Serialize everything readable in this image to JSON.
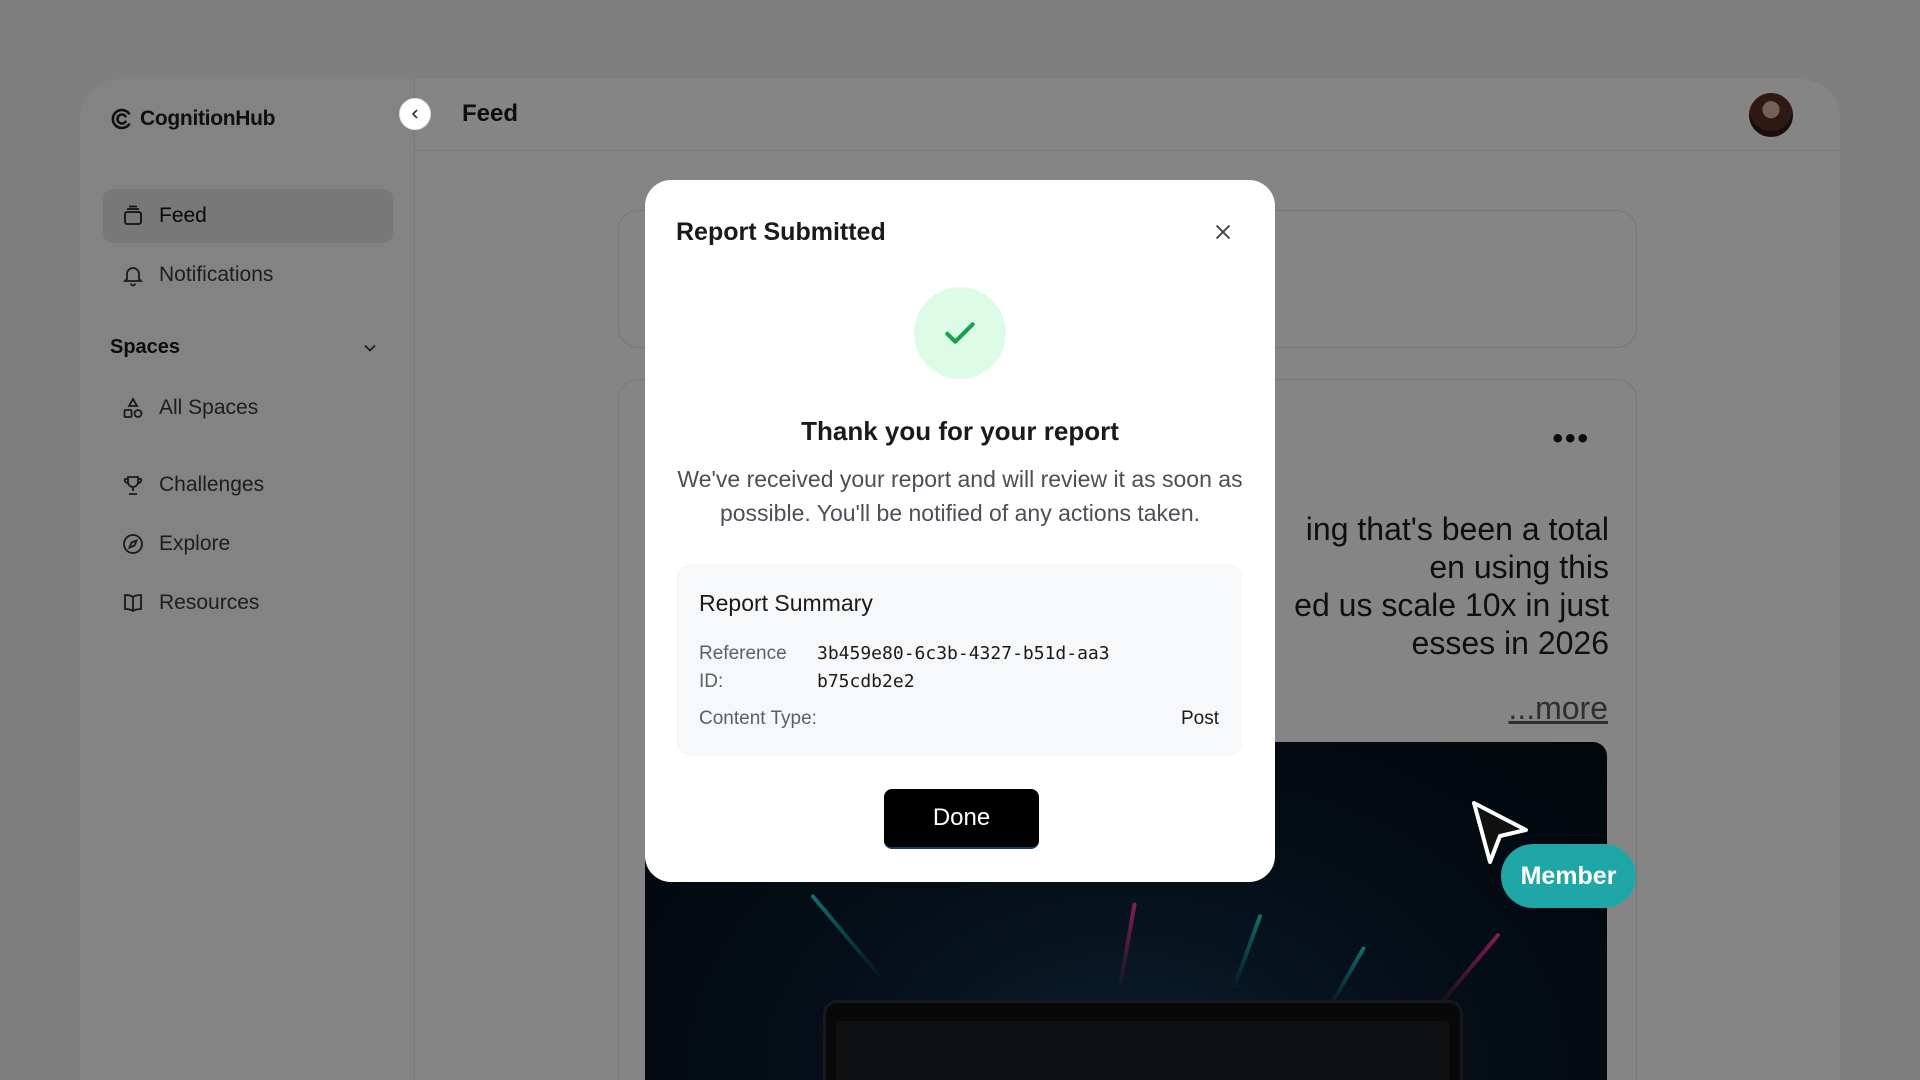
{
  "app": {
    "name": "CognitionHub"
  },
  "header": {
    "title": "Feed"
  },
  "sidebar": {
    "items": [
      {
        "label": "Feed",
        "icon": "feed-icon",
        "active": true
      },
      {
        "label": "Notifications",
        "icon": "bell-icon"
      }
    ],
    "spaces_heading": "Spaces",
    "spaces_items": [
      {
        "label": "All Spaces",
        "icon": "shapes-icon"
      },
      {
        "label": "Challenges",
        "icon": "trophy-icon"
      },
      {
        "label": "Explore",
        "icon": "compass-icon"
      },
      {
        "label": "Resources",
        "icon": "book-icon"
      }
    ]
  },
  "post": {
    "text_lines": [
      "ing that's been a total",
      "en using this",
      "ed us scale 10x in just",
      "esses in 2026"
    ],
    "more_label": "...more",
    "menu_label": "•••"
  },
  "modal": {
    "title": "Report Submitted",
    "heading": "Thank you for your report",
    "description": "We've received your report and will review it as soon as possible. You'll be notified of any actions taken.",
    "summary": {
      "title": "Report Summary",
      "reference_label": "Reference ID:",
      "reference_value": "3b459e80-6c3b-4327-b51d-aa3b75cdb2e2",
      "content_type_label": "Content Type:",
      "content_type_value": "Post"
    },
    "done_label": "Done"
  },
  "badge": {
    "label": "Member"
  },
  "colors": {
    "success_bg": "#dcfce7",
    "success_icon": "#16a34a",
    "badge": "#1fa6a6",
    "overlay": "rgba(0,0,0,0.48)"
  }
}
